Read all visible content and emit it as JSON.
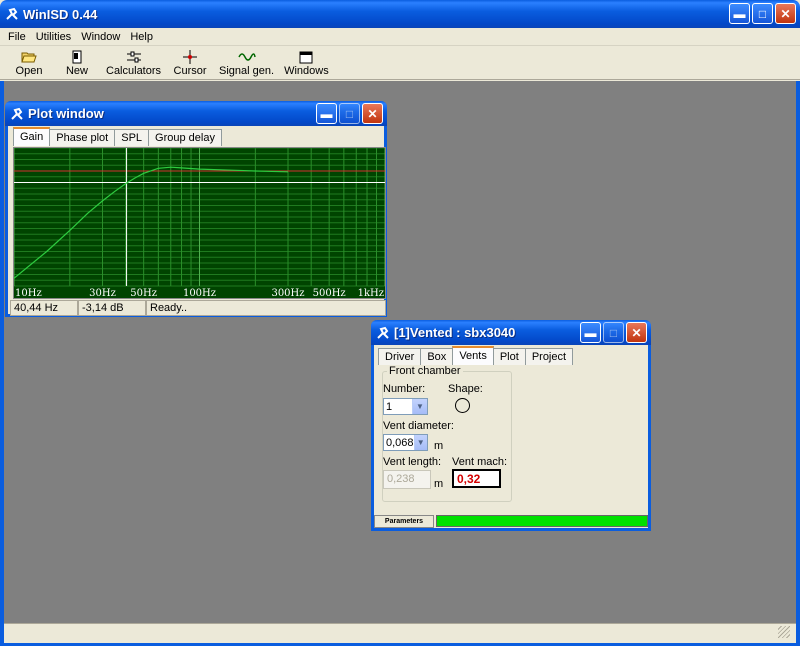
{
  "app": {
    "title": "WinISD 0.44"
  },
  "menu": {
    "items": [
      "File",
      "Utilities",
      "Window",
      "Help"
    ]
  },
  "toolbar": {
    "items": [
      {
        "label": "Open",
        "icon": "folder-open-icon"
      },
      {
        "label": "New",
        "icon": "new-document-icon"
      },
      {
        "label": "Calculators",
        "icon": "calculator-icon"
      },
      {
        "label": "Cursor",
        "icon": "cursor-crosshair-icon"
      },
      {
        "label": "Signal gen.",
        "icon": "sine-wave-icon"
      },
      {
        "label": "Windows",
        "icon": "window-icon"
      }
    ]
  },
  "plot_window": {
    "title": "Plot window",
    "tabs": [
      "Gain",
      "Phase plot",
      "SPL",
      "Group delay"
    ],
    "active_tab": "Gain",
    "status": {
      "frequency": "40,44 Hz",
      "value": "-3,14 dB",
      "message": "Ready.."
    }
  },
  "chart_data": {
    "type": "line",
    "x_scale": "log",
    "xlim": [
      10,
      1000
    ],
    "x_tick_labels": [
      {
        "x": 10,
        "label": "10Hz"
      },
      {
        "x": 30,
        "label": "30Hz"
      },
      {
        "x": 50,
        "label": "50Hz"
      },
      {
        "x": 100,
        "label": "100Hz"
      },
      {
        "x": 300,
        "label": "300Hz"
      },
      {
        "x": 500,
        "label": "500Hz"
      },
      {
        "x": 1000,
        "label": "1kHz"
      }
    ],
    "ylim": [
      -30,
      6
    ],
    "grid": true,
    "series": [
      {
        "color": "#2ecc40",
        "x": [
          10,
          15,
          20,
          25,
          30,
          35,
          40.44,
          45,
          50,
          60,
          70,
          80,
          100,
          150,
          200,
          300
        ],
        "y": [
          -28,
          -21,
          -15.5,
          -11,
          -7.8,
          -5.3,
          -3.14,
          -1.8,
          -0.6,
          0.7,
          1.0,
          0.8,
          0.5,
          0.2,
          0.0,
          -0.2
        ]
      }
    ],
    "reference_lines": [
      {
        "y": 0,
        "color": "#d03030"
      },
      {
        "y": -3,
        "color": "#ffffff"
      }
    ],
    "cursor": {
      "x": 40.44,
      "y": -3.14,
      "color": "#ffffff"
    }
  },
  "vented_window": {
    "title": "[1]Vented : sbx3040",
    "tabs": [
      "Driver",
      "Box",
      "Vents",
      "Plot",
      "Project"
    ],
    "active_tab": "Vents",
    "group_title": "Front chamber",
    "number_label": "Number:",
    "number_value": "1",
    "shape_label": "Shape:",
    "diameter_label": "Vent diameter:",
    "diameter_value": "0,068",
    "diameter_unit": "m",
    "length_label": "Vent length:",
    "length_value": "0,238",
    "length_unit": "m",
    "mach_label": "Vent mach:",
    "mach_value": "0,32",
    "bottom_tab": "Parameters"
  }
}
